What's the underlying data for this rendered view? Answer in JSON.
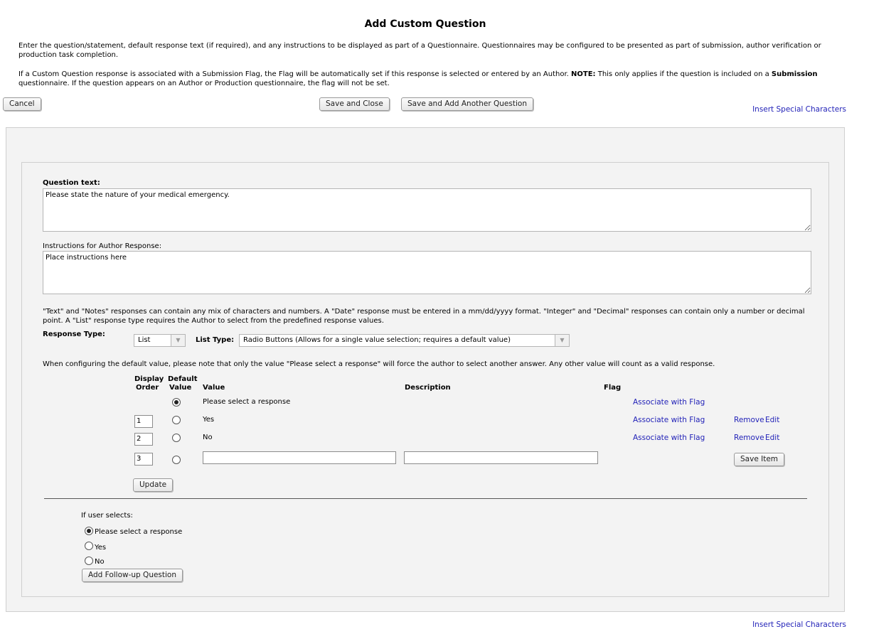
{
  "page": {
    "title": "Add Custom Question",
    "intro1": "Enter the question/statement, default response text (if required), and any instructions to be displayed as part of a Questionnaire. Questionnaires may be configured to be presented as part of submission, author verification or production task completion.",
    "intro2_a": "If a Custom Question response is associated with a Submission Flag, the Flag will be automatically set if this response is selected or entered by an Author. ",
    "intro2_note": "NOTE:",
    "intro2_b": " This only applies if the question is included on a ",
    "intro2_submission": "Submission",
    "intro2_c": " questionnaire. If the question appears on an Author or Production questionnaire, the flag will not be set."
  },
  "toolbar": {
    "cancel": "Cancel",
    "save_close": "Save and Close",
    "save_add": "Save and Add Another Question",
    "insert_special_top": "Insert Special Characters",
    "insert_special_bottom": "Insert Special Characters"
  },
  "form": {
    "question_label": "Question text:",
    "question_value": "Please state the nature of your medical emergency.",
    "instructions_label": "Instructions for Author Response:",
    "instructions_value": "Place instructions here",
    "response_info": "\"Text\" and \"Notes\" responses can contain any mix of characters and numbers. A \"Date\" response must be entered in a mm/dd/yyyy format. \"Integer\" and \"Decimal\" responses can contain only a number or decimal point. A \"List\" response type requires the Author to select from the predefined response values.",
    "response_type_label": "Response Type:",
    "response_type_value": "List",
    "list_type_label": "List Type:",
    "list_type_value": "Radio Buttons (Allows for a single value selection; requires a default value)",
    "default_note": "When configuring the default value, please note that only the value \"Please select a response\" will force the author to select another answer. Any other value will count as a valid response."
  },
  "table": {
    "headers": {
      "display": "Display",
      "order": "Order",
      "default": "Default",
      "value_col": "Value",
      "value": "Value",
      "description": "Description",
      "flag": "Flag"
    },
    "rows": [
      {
        "order": "",
        "value": "Please select a response",
        "flag_link": "Associate with Flag",
        "default": true
      },
      {
        "order": "1",
        "value": "Yes",
        "flag_link": "Associate with Flag",
        "remove": "Remove",
        "edit": "Edit",
        "default": false
      },
      {
        "order": "2",
        "value": "No",
        "flag_link": "Associate with Flag",
        "remove": "Remove",
        "edit": "Edit",
        "default": false
      }
    ],
    "new_row": {
      "order": "3",
      "value": "",
      "description": "",
      "save": "Save Item"
    },
    "update": "Update"
  },
  "followup": {
    "label": "If user selects:",
    "options": [
      {
        "label": "Please select a response",
        "checked": true
      },
      {
        "label": "Yes",
        "checked": false
      },
      {
        "label": "No",
        "checked": false
      }
    ],
    "add_button": "Add Follow-up Question"
  }
}
